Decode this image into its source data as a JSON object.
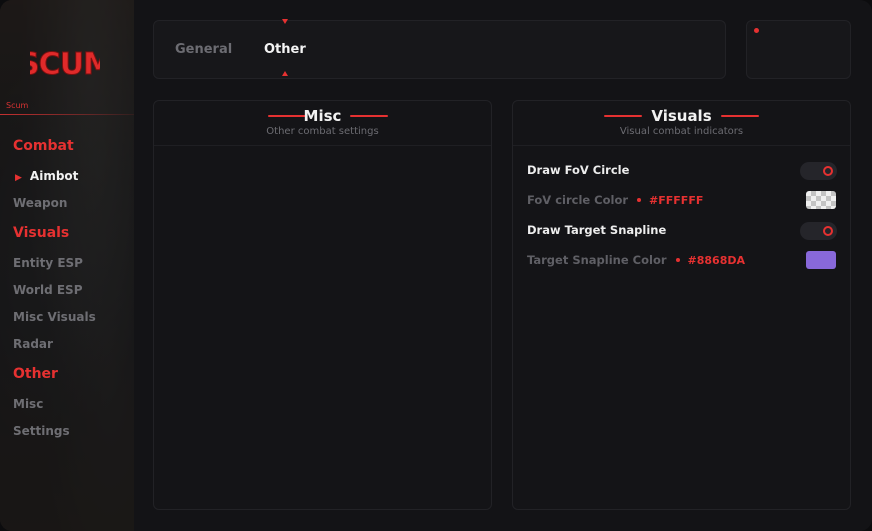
{
  "brand": {
    "logo_text": "SCUM",
    "subtitle": "Scum",
    "accent": "#E63131"
  },
  "sidebar": {
    "sections": [
      {
        "label": "Combat",
        "items": [
          {
            "label": "Aimbot",
            "active": true
          },
          {
            "label": "Weapon",
            "active": false
          }
        ]
      },
      {
        "label": "Visuals",
        "items": [
          {
            "label": "Entity ESP"
          },
          {
            "label": "World ESP"
          },
          {
            "label": "Misc Visuals"
          },
          {
            "label": "Radar"
          }
        ]
      },
      {
        "label": "Other",
        "items": [
          {
            "label": "Misc"
          },
          {
            "label": "Settings"
          }
        ]
      }
    ]
  },
  "tabs": [
    {
      "label": "General",
      "active": false
    },
    {
      "label": "Other",
      "active": true
    }
  ],
  "panels": {
    "misc": {
      "title": "Misc",
      "subtitle": "Other combat settings"
    },
    "visuals": {
      "title": "Visuals",
      "subtitle": "Visual combat indicators",
      "rows": [
        {
          "label": "Draw FoV Circle",
          "type": "toggle",
          "enabled": true
        },
        {
          "label": "FoV circle Color",
          "type": "color",
          "value": "#FFFFFF"
        },
        {
          "label": "Draw Target Snapline",
          "type": "toggle",
          "enabled": true
        },
        {
          "label": "Target Snapline Color",
          "type": "color",
          "value": "#8868DA"
        }
      ]
    }
  },
  "colors": {
    "snapline_swatch": "#8868DA",
    "fov_swatch": "#FFFFFF"
  }
}
